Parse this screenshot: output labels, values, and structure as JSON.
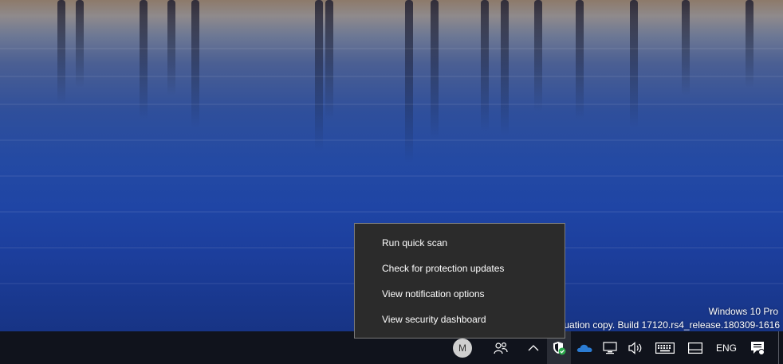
{
  "desktop": {
    "watermark": {
      "line1": "Windows 10 Pro",
      "line2": "Evaluation copy. Build 17120.rs4_release.180309-1616"
    }
  },
  "context_menu": {
    "items": [
      {
        "label": "Run quick scan"
      },
      {
        "label": "Check for protection updates"
      },
      {
        "label": "View notification options"
      },
      {
        "label": "View security dashboard"
      }
    ]
  },
  "taskbar": {
    "avatar_initial": "M",
    "language": "ENG",
    "icons": [
      "user-avatar",
      "people-icon",
      "chevron-up-icon",
      "windows-security-icon",
      "onedrive-icon",
      "network-icon",
      "volume-icon",
      "touch-keyboard-icon",
      "windows-ink-icon",
      "action-center-icon"
    ]
  },
  "colors": {
    "taskbar_bg": "#10131c",
    "menu_bg": "#2b2b2b",
    "menu_border": "#7a7a7a",
    "onedrive_blue": "#2b7cd3",
    "security_green": "#2aa84a"
  }
}
